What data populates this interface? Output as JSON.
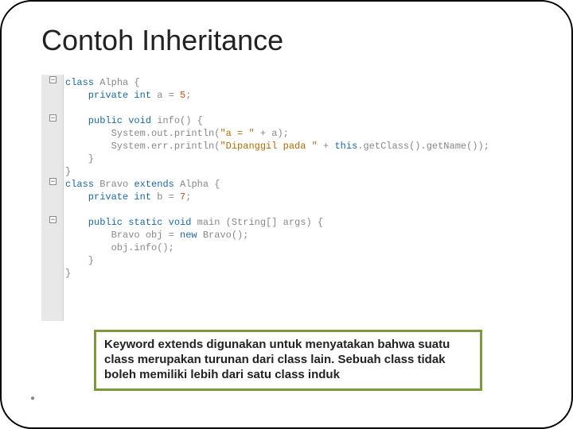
{
  "title": "Contoh Inheritance",
  "code": {
    "l1": "class",
    "l1b": " Alpha {",
    "l2a": "    private int",
    "l2b": " a = ",
    "l2n": "5",
    "l2c": ";",
    "l3": "",
    "l4a": "    public void",
    "l4b": " info() {",
    "l5a": "        System.out.println(",
    "l5s": "\"a = \"",
    "l5b": " + a);",
    "l6a": "        System.err.println(",
    "l6s": "\"Dipanggil pada \"",
    "l6b": " + ",
    "l6c": "this",
    "l6d": ".getClass().getName());",
    "l7": "    }",
    "l8": "}",
    "l9a": "class",
    "l9b": " Bravo ",
    "l9c": "extends",
    "l9d": " Alpha {",
    "l10a": "    private int",
    "l10b": " b = ",
    "l10n": "7",
    "l10c": ";",
    "l11": "",
    "l12a": "    public static void",
    "l12b": " main (String[] args) {",
    "l13a": "        Bravo obj = ",
    "l13b": "new",
    "l13c": " Bravo();",
    "l14": "        obj.info();",
    "l15": "    }",
    "l16": "}"
  },
  "callout": "Keyword extends digunakan untuk menyatakan bahwa suatu class merupakan turunan dari class lain. Sebuah class tidak boleh memiliki lebih dari satu class induk",
  "fold_glyph": "−"
}
